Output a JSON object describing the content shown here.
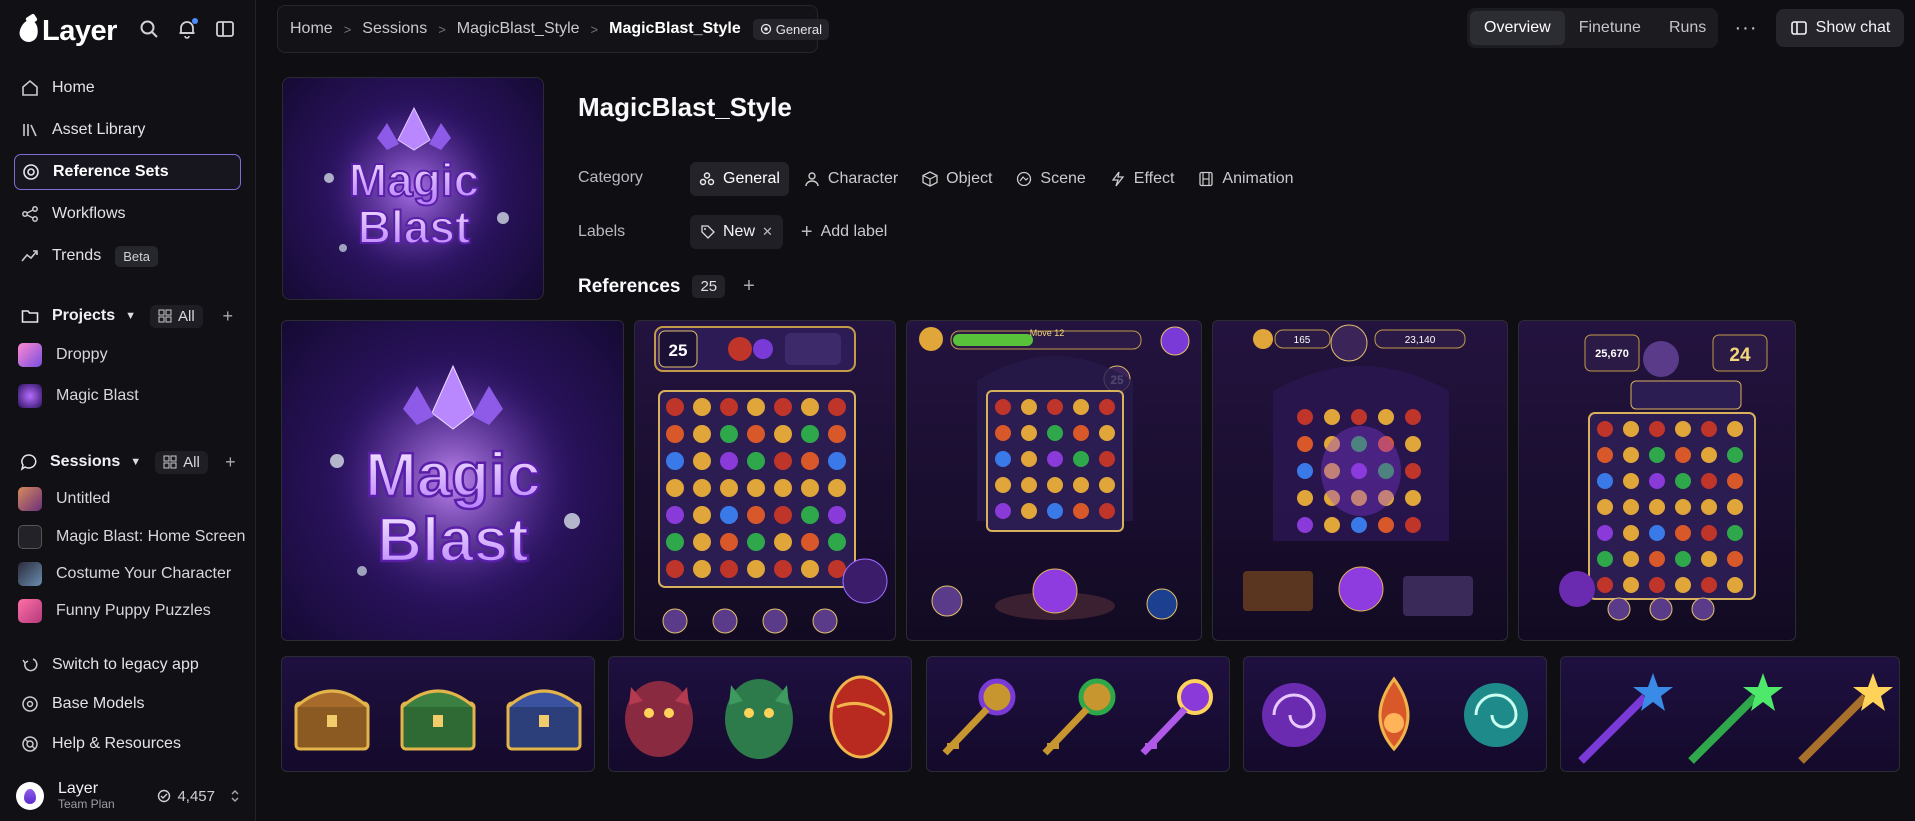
{
  "app": {
    "brand": "Layer",
    "icons": [
      "search-icon",
      "bell-icon",
      "sidebar-toggle-icon"
    ]
  },
  "sidebar": {
    "nav": [
      {
        "label": "Home",
        "icon": "home-icon"
      },
      {
        "label": "Asset Library",
        "icon": "library-icon"
      },
      {
        "label": "Reference Sets",
        "icon": "reference-icon",
        "active": true
      },
      {
        "label": "Workflows",
        "icon": "workflow-icon"
      },
      {
        "label": "Trends",
        "icon": "trend-icon",
        "badge": "Beta"
      }
    ],
    "projects": {
      "title": "Projects",
      "all_label": "All",
      "items": [
        {
          "label": "Droppy"
        },
        {
          "label": "Magic Blast"
        }
      ]
    },
    "sessions": {
      "title": "Sessions",
      "all_label": "All",
      "items": [
        {
          "label": "Untitled"
        },
        {
          "label": "Magic Blast: Home Screen"
        },
        {
          "label": "Costume Your Character"
        },
        {
          "label": "Funny Puppy Puzzles"
        }
      ]
    },
    "bottom_links": [
      {
        "label": "Switch to legacy app",
        "icon": "switch-icon"
      },
      {
        "label": "Base Models",
        "icon": "models-icon"
      },
      {
        "label": "Help & Resources",
        "icon": "help-icon"
      }
    ],
    "account": {
      "name": "Layer",
      "plan": "Team Plan",
      "credits": "4,457"
    }
  },
  "topbar": {
    "breadcrumb": [
      "Home",
      "Sessions",
      "MagicBlast_Style"
    ],
    "current": "MagicBlast_Style",
    "tag": "General",
    "tabs": [
      {
        "label": "Overview",
        "active": true
      },
      {
        "label": "Finetune"
      },
      {
        "label": "Runs"
      }
    ],
    "chat_button": "Show chat"
  },
  "main": {
    "title": "MagicBlast_Style",
    "cover_text": [
      "Magic",
      "Blast"
    ],
    "category_label": "Category",
    "categories": [
      {
        "label": "General",
        "active": true,
        "icon": "general-icon"
      },
      {
        "label": "Character",
        "icon": "character-icon"
      },
      {
        "label": "Object",
        "icon": "object-icon"
      },
      {
        "label": "Scene",
        "icon": "scene-icon"
      },
      {
        "label": "Effect",
        "icon": "effect-icon"
      },
      {
        "label": "Animation",
        "icon": "animation-icon"
      }
    ],
    "labels_label": "Labels",
    "labels": [
      {
        "label": "New"
      }
    ],
    "add_label": "Add label",
    "references_title": "References",
    "references_count": "25",
    "game_screens": [
      {
        "top_numbers": [
          "25"
        ]
      },
      {
        "top_text": "Move 12",
        "top_numbers": [
          "25"
        ]
      },
      {
        "top_numbers": [
          "165",
          "23,140"
        ]
      },
      {
        "top_numbers": [
          "25,670",
          "24"
        ]
      }
    ]
  },
  "colors": {
    "accent": "#7a6fd6",
    "background": "#0f0f13",
    "purple": "#8e5cf2"
  }
}
